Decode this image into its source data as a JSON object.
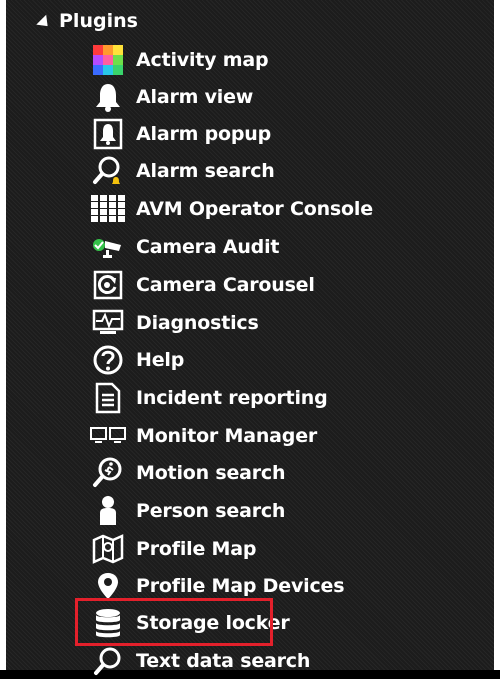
{
  "tree": {
    "section_label": "Plugins",
    "items": [
      {
        "label": "Activity map",
        "icon": "activity-map-icon"
      },
      {
        "label": "Alarm view",
        "icon": "bell-icon"
      },
      {
        "label": "Alarm popup",
        "icon": "alarm-popup-icon"
      },
      {
        "label": "Alarm search",
        "icon": "alarm-search-icon"
      },
      {
        "label": "AVM Operator Console",
        "icon": "grid-icon"
      },
      {
        "label": "Camera Audit",
        "icon": "camera-audit-icon"
      },
      {
        "label": "Camera Carousel",
        "icon": "camera-carousel-icon"
      },
      {
        "label": "Diagnostics",
        "icon": "diagnostics-icon"
      },
      {
        "label": "Help",
        "icon": "help-icon"
      },
      {
        "label": "Incident reporting",
        "icon": "document-icon"
      },
      {
        "label": "Monitor Manager",
        "icon": "monitors-icon"
      },
      {
        "label": "Motion search",
        "icon": "motion-search-icon"
      },
      {
        "label": "Person search",
        "icon": "person-icon"
      },
      {
        "label": "Profile Map",
        "icon": "map-icon"
      },
      {
        "label": "Profile Map Devices",
        "icon": "map-devices-icon"
      },
      {
        "label": "Storage locker",
        "icon": "database-icon",
        "highlighted": true
      },
      {
        "label": "Text data search",
        "icon": "text-search-icon"
      }
    ]
  },
  "colors": {
    "background": "#1c1c1c",
    "text": "#ffffff",
    "highlight_border": "#e3202b"
  }
}
